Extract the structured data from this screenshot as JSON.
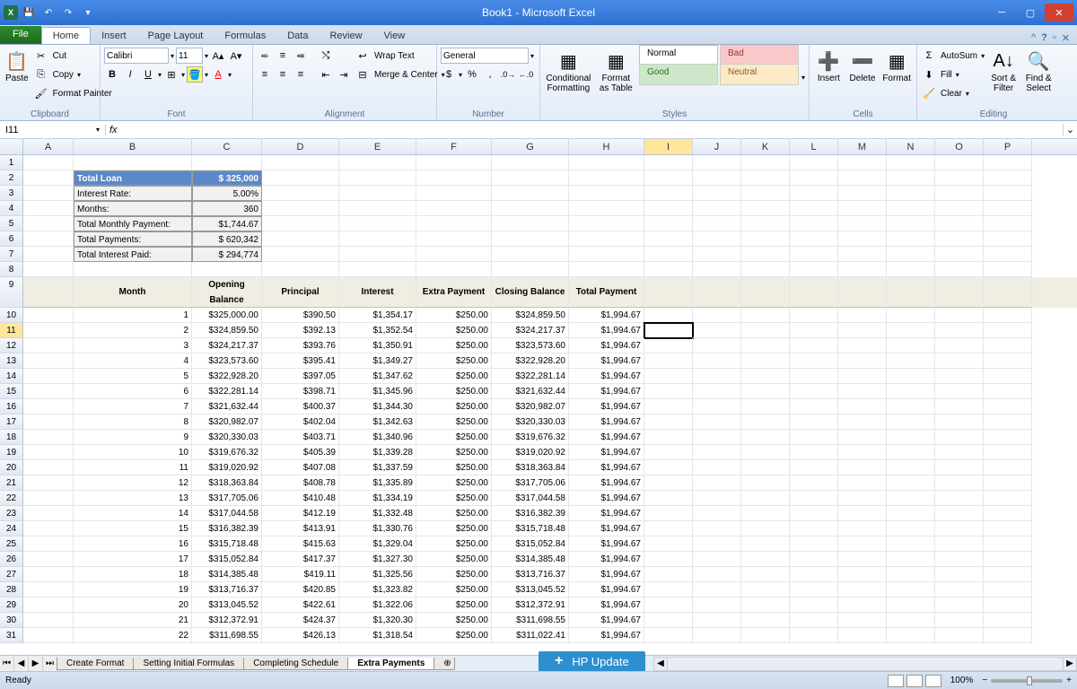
{
  "window": {
    "title": "Book1 - Microsoft Excel"
  },
  "tabs": {
    "file": "File",
    "home": "Home",
    "insert": "Insert",
    "pagelayout": "Page Layout",
    "formulas": "Formulas",
    "data": "Data",
    "review": "Review",
    "view": "View"
  },
  "ribbon": {
    "clipboard": {
      "label": "Clipboard",
      "paste": "Paste",
      "cut": "Cut",
      "copy": "Copy",
      "painter": "Format Painter"
    },
    "font": {
      "label": "Font",
      "name": "Calibri",
      "size": "11"
    },
    "alignment": {
      "label": "Alignment",
      "wrap": "Wrap Text",
      "merge": "Merge & Center"
    },
    "number": {
      "label": "Number",
      "format": "General"
    },
    "styles": {
      "label": "Styles",
      "cond": "Conditional Formatting",
      "table": "Format as Table",
      "normal": "Normal",
      "bad": "Bad",
      "good": "Good",
      "neutral": "Neutral"
    },
    "cells": {
      "label": "Cells",
      "insert": "Insert",
      "delete": "Delete",
      "format": "Format"
    },
    "editing": {
      "label": "Editing",
      "autosum": "AutoSum",
      "fill": "Fill",
      "clear": "Clear",
      "sort": "Sort & Filter",
      "find": "Find & Select"
    }
  },
  "namebox": "I11",
  "summary": {
    "loan_lbl": "Total Loan",
    "loan_cur": "$",
    "loan_val": "325,000",
    "rate_lbl": "Interest Rate:",
    "rate_val": "5.00%",
    "months_lbl": "Months:",
    "months_val": "360",
    "monthly_lbl": "Total Monthly  Payment:",
    "monthly_val": "$1,744.67",
    "payments_lbl": "Total Payments:",
    "payments_cur": "$",
    "payments_val": "620,342",
    "interest_lbl": "Total Interest Paid:",
    "interest_cur": "$",
    "interest_val": "294,774"
  },
  "headers": {
    "month": "Month",
    "opening": "Opening Balance",
    "principal": "Principal",
    "interest": "Interest",
    "extra": "Extra Payment",
    "closing": "Closing Balance",
    "total": "Total Payment"
  },
  "rows": [
    {
      "m": "1",
      "ob": "$325,000.00",
      "p": "$390.50",
      "i": "$1,354.17",
      "e": "$250.00",
      "cb": "$324,859.50",
      "tp": "$1,994.67"
    },
    {
      "m": "2",
      "ob": "$324,859.50",
      "p": "$392.13",
      "i": "$1,352.54",
      "e": "$250.00",
      "cb": "$324,217.37",
      "tp": "$1,994.67"
    },
    {
      "m": "3",
      "ob": "$324,217.37",
      "p": "$393.76",
      "i": "$1,350.91",
      "e": "$250.00",
      "cb": "$323,573.60",
      "tp": "$1,994.67"
    },
    {
      "m": "4",
      "ob": "$323,573.60",
      "p": "$395.41",
      "i": "$1,349.27",
      "e": "$250.00",
      "cb": "$322,928.20",
      "tp": "$1,994.67"
    },
    {
      "m": "5",
      "ob": "$322,928.20",
      "p": "$397.05",
      "i": "$1,347.62",
      "e": "$250.00",
      "cb": "$322,281.14",
      "tp": "$1,994.67"
    },
    {
      "m": "6",
      "ob": "$322,281.14",
      "p": "$398.71",
      "i": "$1,345.96",
      "e": "$250.00",
      "cb": "$321,632.44",
      "tp": "$1,994.67"
    },
    {
      "m": "7",
      "ob": "$321,632.44",
      "p": "$400.37",
      "i": "$1,344.30",
      "e": "$250.00",
      "cb": "$320,982.07",
      "tp": "$1,994.67"
    },
    {
      "m": "8",
      "ob": "$320,982.07",
      "p": "$402.04",
      "i": "$1,342.63",
      "e": "$250.00",
      "cb": "$320,330.03",
      "tp": "$1,994.67"
    },
    {
      "m": "9",
      "ob": "$320,330.03",
      "p": "$403.71",
      "i": "$1,340.96",
      "e": "$250.00",
      "cb": "$319,676.32",
      "tp": "$1,994.67"
    },
    {
      "m": "10",
      "ob": "$319,676.32",
      "p": "$405.39",
      "i": "$1,339.28",
      "e": "$250.00",
      "cb": "$319,020.92",
      "tp": "$1,994.67"
    },
    {
      "m": "11",
      "ob": "$319,020.92",
      "p": "$407.08",
      "i": "$1,337.59",
      "e": "$250.00",
      "cb": "$318,363.84",
      "tp": "$1,994.67"
    },
    {
      "m": "12",
      "ob": "$318,363.84",
      "p": "$408.78",
      "i": "$1,335.89",
      "e": "$250.00",
      "cb": "$317,705.06",
      "tp": "$1,994.67"
    },
    {
      "m": "13",
      "ob": "$317,705.06",
      "p": "$410.48",
      "i": "$1,334.19",
      "e": "$250.00",
      "cb": "$317,044.58",
      "tp": "$1,994.67"
    },
    {
      "m": "14",
      "ob": "$317,044.58",
      "p": "$412.19",
      "i": "$1,332.48",
      "e": "$250.00",
      "cb": "$316,382.39",
      "tp": "$1,994.67"
    },
    {
      "m": "15",
      "ob": "$316,382.39",
      "p": "$413.91",
      "i": "$1,330.76",
      "e": "$250.00",
      "cb": "$315,718.48",
      "tp": "$1,994.67"
    },
    {
      "m": "16",
      "ob": "$315,718.48",
      "p": "$415.63",
      "i": "$1,329.04",
      "e": "$250.00",
      "cb": "$315,052.84",
      "tp": "$1,994.67"
    },
    {
      "m": "17",
      "ob": "$315,052.84",
      "p": "$417.37",
      "i": "$1,327.30",
      "e": "$250.00",
      "cb": "$314,385.48",
      "tp": "$1,994.67"
    },
    {
      "m": "18",
      "ob": "$314,385.48",
      "p": "$419.11",
      "i": "$1,325.56",
      "e": "$250.00",
      "cb": "$313,716.37",
      "tp": "$1,994.67"
    },
    {
      "m": "19",
      "ob": "$313,716.37",
      "p": "$420.85",
      "i": "$1,323.82",
      "e": "$250.00",
      "cb": "$313,045.52",
      "tp": "$1,994.67"
    },
    {
      "m": "20",
      "ob": "$313,045.52",
      "p": "$422.61",
      "i": "$1,322.06",
      "e": "$250.00",
      "cb": "$312,372.91",
      "tp": "$1,994.67"
    },
    {
      "m": "21",
      "ob": "$312,372.91",
      "p": "$424.37",
      "i": "$1,320.30",
      "e": "$250.00",
      "cb": "$311,698.55",
      "tp": "$1,994.67"
    },
    {
      "m": "22",
      "ob": "$311,698.55",
      "p": "$426.13",
      "i": "$1,318.54",
      "e": "$250.00",
      "cb": "$311,022.41",
      "tp": "$1,994.67"
    }
  ],
  "sheets": {
    "s1": "Create Format",
    "s2": "Setting Initial Formulas",
    "s3": "Completing Schedule",
    "s4": "Extra Payments"
  },
  "status": {
    "ready": "Ready",
    "zoom": "100%"
  },
  "notification": "HP Update",
  "colwidths": {
    "A": 56,
    "B": 132,
    "C": 78,
    "D": 86,
    "E": 86,
    "F": 84,
    "G": 86,
    "H": 84,
    "I": 54,
    "J": 54,
    "K": 54,
    "L": 54,
    "M": 54,
    "N": 54,
    "O": 54,
    "P": 54
  }
}
